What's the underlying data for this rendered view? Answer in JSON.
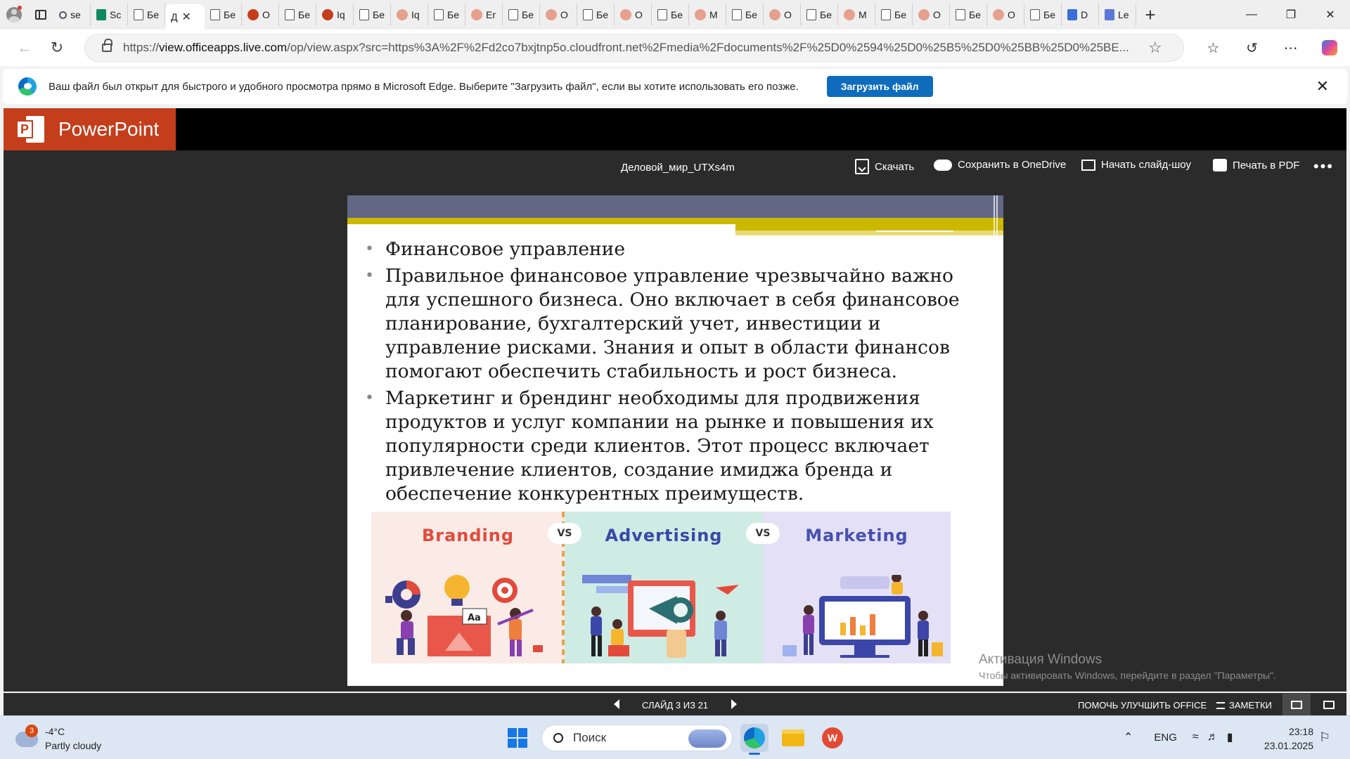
{
  "browser": {
    "tabs": [
      {
        "label": "se",
        "icon": "search"
      },
      {
        "label": "Sc",
        "icon": "green"
      },
      {
        "label": "Бе",
        "icon": "doc"
      },
      {
        "label": "Д",
        "icon": "none",
        "active": true
      },
      {
        "label": "Бе",
        "icon": "doc"
      },
      {
        "label": "O",
        "icon": "ppt"
      },
      {
        "label": "Бе",
        "icon": "doc"
      },
      {
        "label": "Iq",
        "icon": "ppt"
      },
      {
        "label": "Бе",
        "icon": "doc"
      },
      {
        "label": "Iq",
        "icon": "pptl"
      },
      {
        "label": "Бе",
        "icon": "doc"
      },
      {
        "label": "Er",
        "icon": "pptl"
      },
      {
        "label": "Бе",
        "icon": "doc"
      },
      {
        "label": "O",
        "icon": "pptl"
      },
      {
        "label": "Бе",
        "icon": "doc"
      },
      {
        "label": "O",
        "icon": "pptl"
      },
      {
        "label": "Бе",
        "icon": "doc"
      },
      {
        "label": "M",
        "icon": "pptl"
      },
      {
        "label": "Бе",
        "icon": "doc"
      },
      {
        "label": "O",
        "icon": "pptl"
      },
      {
        "label": "Бе",
        "icon": "doc"
      },
      {
        "label": "M",
        "icon": "pptl"
      },
      {
        "label": "Бе",
        "icon": "doc"
      },
      {
        "label": "O",
        "icon": "pptl"
      },
      {
        "label": "Бе",
        "icon": "doc"
      },
      {
        "label": "O",
        "icon": "pptl"
      },
      {
        "label": "Бе",
        "icon": "doc"
      },
      {
        "label": "D",
        "icon": "word"
      },
      {
        "label": "Le",
        "icon": "lens"
      }
    ],
    "url_prefix": "https://",
    "url_host": "view.officeapps.live.com",
    "url_rest": "/op/view.aspx?src=https%3A%2F%2Fd2co7bxjtnp5o.cloudfront.net%2Fmedia%2Fdocuments%2F%25D0%2594%25D0%25B5%25D0%25BB%25D0%25BE..."
  },
  "infobar": {
    "message": "Ваш файл был открыт для быстрого и удобного просмотра прямо в Microsoft Edge. Выберите \"Загрузить файл\", если вы хотите использовать его позже.",
    "button": "Загрузить файл"
  },
  "app": {
    "name": "PowerPoint",
    "doc_title": "Деловой_мир_UTXs4m",
    "commands": {
      "download": "Скачать",
      "save_onedrive": "Сохранить в OneDrive",
      "slideshow": "Начать слайд-шоу",
      "print_pdf": "Печать в PDF"
    }
  },
  "slide": {
    "bullets": [
      "Финансовое управление",
      "Правильное финансовое управление чрезвычайно важно для успешного бизнеса. Оно включает в себя финансовое планирование, бухгалтерский учет, инвестиции и управление рисками. Знания и опыт в области финансов помогают обеспечить стабильность и рост бизнеса.",
      "Маркетинг и брендинг необходимы для продвижения продуктов и услуг компании на рынке и повышения их популярности среди клиентов. Этот процесс включает привлечение клиентов, создание имиджа бренда и обеспечение конкурентных преимуществ."
    ],
    "image": {
      "branding": "Branding",
      "advertising": "Advertising",
      "marketing": "Marketing",
      "vs": "VS",
      "aa": "Aa"
    }
  },
  "watermark": {
    "title": "Активация Windows",
    "subtitle": "Чтобы активировать Windows, перейдите в раздел \"Параметры\"."
  },
  "status": {
    "slide_counter": "СЛАЙД 3 ИЗ 21",
    "help": "ПОМОЧЬ УЛУЧШИТЬ OFFICE",
    "notes": "ЗАМЕТКИ"
  },
  "taskbar": {
    "weather_badge": "3",
    "temperature": "-4°C",
    "condition": "Partly cloudy",
    "search_placeholder": "Поиск",
    "lang": "ENG",
    "time": "23:18",
    "date": "23.01.2025"
  }
}
